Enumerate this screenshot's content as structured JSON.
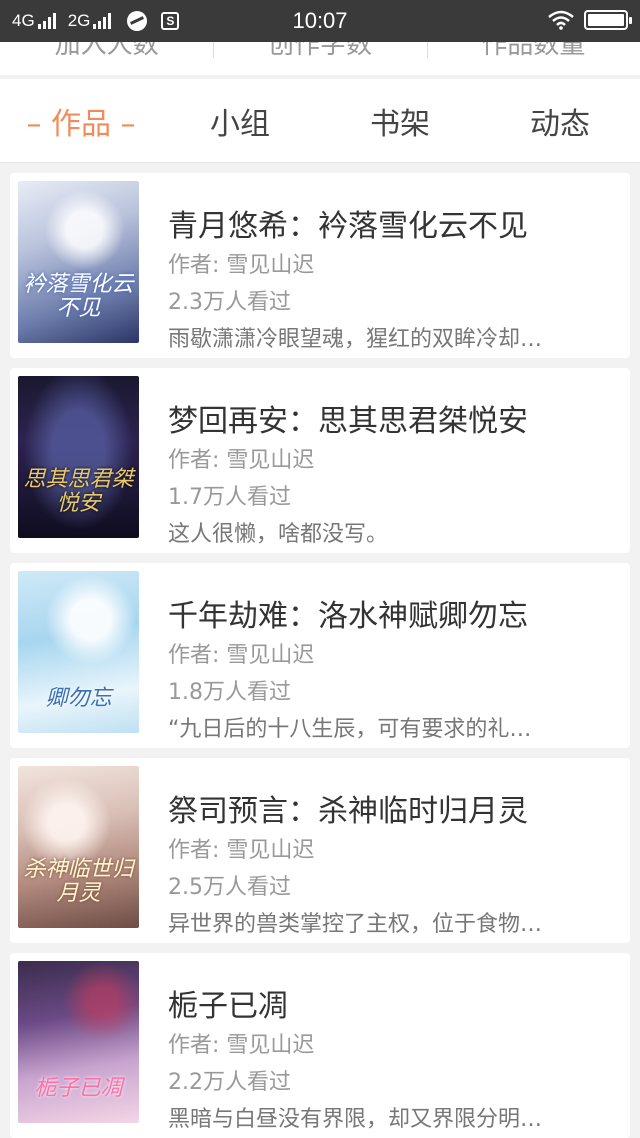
{
  "status_bar": {
    "network_1": "4G",
    "network_2": "2G",
    "time": "10:07",
    "icons": [
      "signal-icon",
      "signal-icon",
      "app-circle-icon",
      "s-badge-icon",
      "wifi-icon",
      "battery-icon"
    ]
  },
  "stats": {
    "labels": [
      "加入人数",
      "创作字数",
      "作品数量"
    ]
  },
  "tabs": [
    {
      "label": "– 作品 –",
      "active": true
    },
    {
      "label": "小组",
      "active": false
    },
    {
      "label": "书架",
      "active": false
    },
    {
      "label": "动态",
      "active": false
    }
  ],
  "colors": {
    "accent": "#f08c5a",
    "status_bar": "#3a3a3a"
  },
  "works": [
    {
      "title": "青月悠希：衿落雪化云不见",
      "author": "作者: 雪见山迟",
      "views": "2.3万人看过",
      "description": "雨歇潇潇冷眼望魂，猩红的双眸冷却…",
      "cover_text": "衿落雪化云不见"
    },
    {
      "title": "梦回再安：思其思君桀悦安",
      "author": "作者: 雪见山迟",
      "views": "1.7万人看过",
      "description": "这人很懒，啥都没写。",
      "cover_text": "思其思君桀悦安"
    },
    {
      "title": "千年劫难：洛水神赋卿勿忘",
      "author": "作者: 雪见山迟",
      "views": "1.8万人看过",
      "description": "“九日后的十八生辰，可有要求的礼…",
      "cover_text": "卿勿忘"
    },
    {
      "title": "祭司预言：杀神临时归月灵",
      "author": "作者: 雪见山迟",
      "views": "2.5万人看过",
      "description": "异世界的兽类掌控了主权，位于食物…",
      "cover_text": "杀神临世归月灵"
    },
    {
      "title": "栀子已凋",
      "author": "作者: 雪见山迟",
      "views": "2.2万人看过",
      "description": "黑暗与白昼没有界限，却又界限分明…",
      "cover_text": "栀子已凋"
    }
  ]
}
